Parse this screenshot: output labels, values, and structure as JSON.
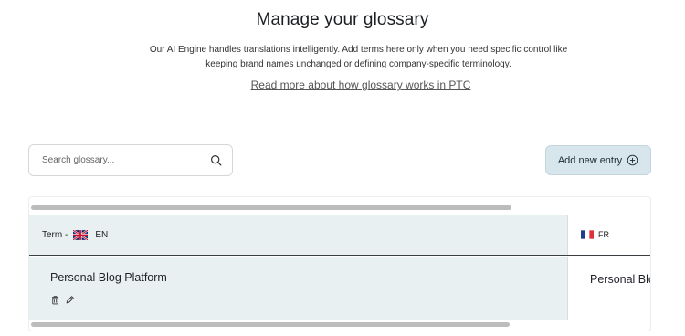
{
  "header": {
    "title": "Manage your glossary",
    "description": "Our AI Engine handles translations intelligently. Add terms here only when you need specific control like keeping brand names unchanged or defining company-specific terminology.",
    "read_more": "Read more about how glossary works in PTC"
  },
  "search": {
    "placeholder": "Search glossary...",
    "value": "",
    "icon": "search-icon"
  },
  "actions": {
    "add_entry_label": "Add new entry",
    "add_entry_icon": "plus-circle-icon",
    "accent_color": "#d6e6ec"
  },
  "table": {
    "columns": [
      {
        "prefix": "Term -",
        "lang": "EN",
        "flag": "uk-flag-icon"
      },
      {
        "prefix": "",
        "lang": "FR",
        "flag": "fr-flag-icon"
      }
    ],
    "rows": [
      {
        "term": "Personal Blog Platform",
        "fr": "Personal Blog Platform"
      }
    ],
    "row_actions": [
      "delete-icon",
      "edit-icon"
    ]
  }
}
